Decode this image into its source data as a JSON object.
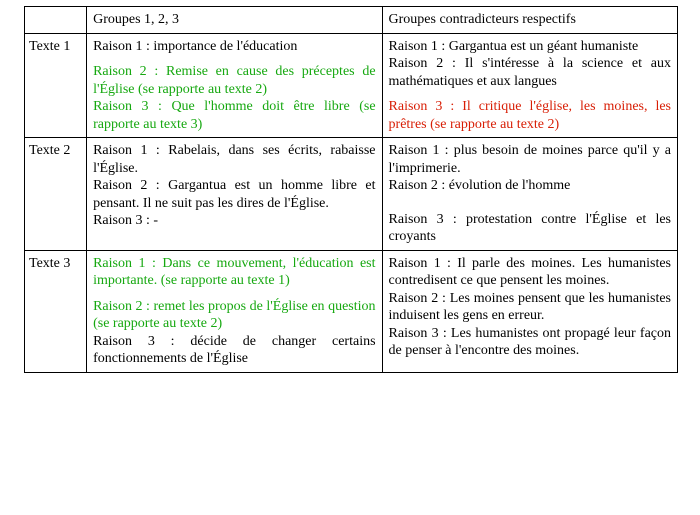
{
  "header": {
    "col1": "Groupes 1, 2, 3",
    "col2": "Groupes contradicteurs respectifs"
  },
  "rows": [
    {
      "label": "Texte 1",
      "g": {
        "r1": "Raison 1 : importance de l'éducation",
        "r2": "Raison 2 : Remise en cause des préceptes de l'Église (se rapporte au texte 2)",
        "r3": "Raison 3 : Que l'homme doit être libre (se rapporte au texte 3)"
      },
      "c": {
        "r1": "Raison 1 : Gargantua est un géant humaniste",
        "r2": "Raison 2 : Il s'intéresse à la science et aux mathématiques et aux langues",
        "r3": "Raison 3 : Il critique l'église, les moines, les prêtres (se rapporte au texte 2)"
      }
    },
    {
      "label": "Texte 2",
      "g": {
        "r1": "Raison 1 : Rabelais, dans ses écrits, rabaisse l'Église.",
        "r2": "Raison 2 : Gargantua est un homme libre et pensant. Il ne suit pas les dires de l'Église.",
        "r3": "Raison 3 : -"
      },
      "c": {
        "r1": "Raison 1 : plus besoin de moines parce qu'il y a l'imprimerie.",
        "r2": "Raison 2 : évolution de l'homme",
        "r3": "Raison 3 : protestation contre l'Église et les croyants"
      }
    },
    {
      "label": "Texte 3",
      "g": {
        "r1": "Raison 1 : Dans ce mouvement, l'éducation est importante. (se rapporte au texte 1)",
        "r2": "Raison 2 : remet les propos de l'Église en question (se rapporte au texte 2)",
        "r3": "Raison 3 : décide de changer certains fonctionnements de l'Église"
      },
      "c": {
        "r1": "Raison 1 : Il parle des moines. Les humanistes contredisent ce que pensent les moines.",
        "r2": "Raison 2 : Les moines pensent que les humanistes induisent les gens en erreur.",
        "r3": "Raison 3 : Les humanistes ont propagé leur façon de penser à l'encontre des moines."
      }
    }
  ]
}
